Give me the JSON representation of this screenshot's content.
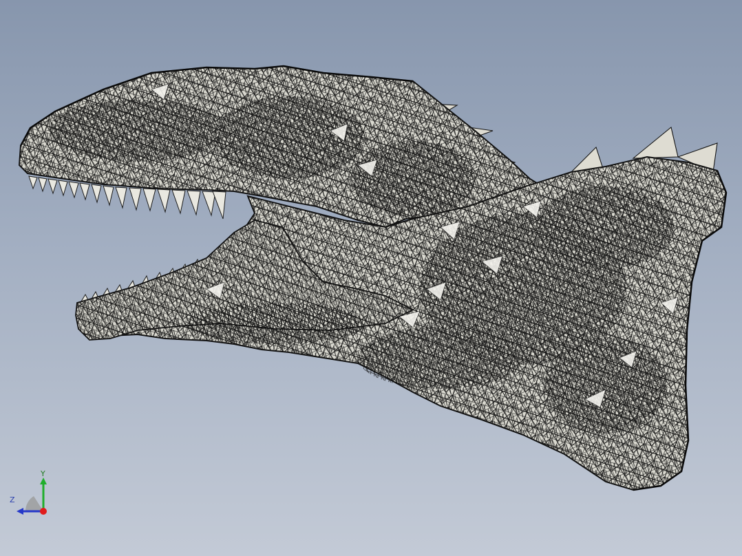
{
  "viewport": {
    "background_top": "#8796ad",
    "background_bottom": "#c3cad6",
    "model": {
      "fill_color": "#d9d8cf",
      "wire_color": "#161616",
      "style": "shaded-with-edges"
    }
  },
  "triad": {
    "y_label": "Y",
    "z_label": "Z",
    "y_color": "#1fae2b",
    "z_color": "#2538c9",
    "x_color": "#e01b1b"
  }
}
